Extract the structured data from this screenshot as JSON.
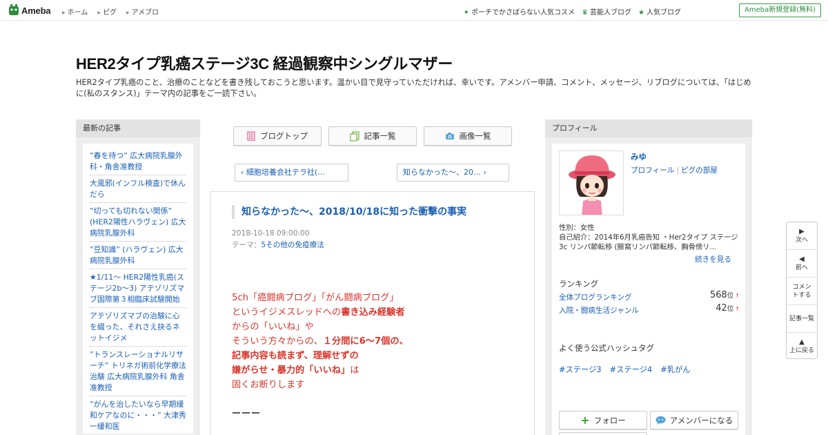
{
  "topbar": {
    "logo": "Ameba",
    "nav": [
      "ホーム",
      "ピグ",
      "アメブロ"
    ],
    "right_links": [
      {
        "icon": "sparkle-icon",
        "label": "ポーチでかさばらない人気コスメ"
      },
      {
        "icon": "crown-icon",
        "label": "芸能人ブログ"
      },
      {
        "icon": "star-icon",
        "label": "人気ブログ"
      }
    ],
    "register_label": "Ameba新規登録(無料)"
  },
  "blog": {
    "title": "HER2タイプ乳癌ステージ3C 経過観察中シングルマザー",
    "description": "HER2タイプ乳癌のこと、治療のことなどを書き残しておこうと思います。温かい目で見守っていただければ、幸いです。アメンバー申請、コメント、メッセージ、リブログについては、「はじめに(私のスタンス)」テーマ内の記事をご一読下さい。"
  },
  "left": {
    "heading": "最新の記事",
    "items": [
      "”春を待つ” 広大病院乳腺外科・角舎准教授",
      "大風邪(インフル検査)で休んだら",
      "”切っても切れない関係” (HER2陽性ハラヴェン) 広大病院乳腺外科",
      "”豆知識” (ハラヴェン) 広大病院乳腺外科",
      "★1/11～ HER2陽性乳癌(ステージ2b～3) アテゾリズマブ国際第３相臨床試験開始",
      "アテゾリズマブの治験に心を綴った、それさえ抉るネットイジメ",
      "”トランスレーショナルリサーチ” トリネガ術前化学療法治験 広大病院乳腺外科 角舎准教授",
      "”がんを治したいなら早期緩和ケアなのに・・・” 大津秀一緩和医"
    ]
  },
  "center": {
    "buttons": [
      {
        "icon": "document-icon",
        "label": "ブログトップ"
      },
      {
        "icon": "pages-icon",
        "label": "記事一覧"
      },
      {
        "icon": "camera-icon",
        "label": "画像一覧"
      }
    ],
    "prev_label": "細胞培養会社テラ社(…",
    "next_label": "知らなかった～、20…"
  },
  "article": {
    "title": "知らなかった～、2018/10/18に知った衝撃の事実",
    "date": "2018-10-18 09:00:00",
    "theme_prefix": "テーマ：",
    "theme": "5その他の免疫療法",
    "lines": [
      [
        {
          "t": "5ch「癌闘病ブログ」「がん闘病ブログ」",
          "b": false
        }
      ],
      [
        {
          "t": "というイジメスレッドへの",
          "b": false
        },
        {
          "t": "書き込み経験者",
          "b": true
        }
      ],
      [
        {
          "t": "からの「いいね」や",
          "b": false
        }
      ],
      [
        {
          "t": "そういう方々からの、",
          "b": false
        },
        {
          "t": "１分間に6～7個の、",
          "b": true
        }
      ],
      [
        {
          "t": "記事内容も読まず、理解せずの",
          "b": true
        }
      ],
      [
        {
          "t": "嫌がらせ・暴力的「いいね」",
          "b": true
        },
        {
          "t": "は",
          "b": false
        }
      ],
      [
        {
          "t": "固くお断りします",
          "b": false
        }
      ]
    ],
    "separator": "ーーー"
  },
  "profile": {
    "heading": "プロフィール",
    "name": "みゆ",
    "link_profile": "プロフィール",
    "link_room": "ピグの部屋",
    "gender": "性別：女性",
    "intro_1": "自己紹介：2014年6月乳癌告知 ・Her2タイプ ステージ3c リンパ節転移 (腋窩リンパ節転移、胸骨傍リ...",
    "more": "続きを見る",
    "ranking_heading": "ランキング",
    "rankings": [
      {
        "label": "全体ブログランキング",
        "value": "568",
        "unit": "位",
        "trend": "↑"
      },
      {
        "label": "入院・闘病生活ジャンル",
        "value": "42",
        "unit": "位",
        "trend": "↑"
      }
    ],
    "hashtag_heading": "よく使う公式ハッシュタグ",
    "hashtags": [
      "#ステージ3",
      "#ステージ4",
      "#乳がん"
    ],
    "follow_label": "フォロー",
    "amember_label": "アメンバーになる"
  },
  "floatnav": {
    "next": "次へ",
    "prev": "前へ",
    "comment": "コメントする",
    "list": "記事一覧",
    "top": "上に戻る"
  },
  "colors": {
    "link": "#1a5fb4",
    "accent_red": "#d8362b",
    "brand_green": "#2d8c3c"
  }
}
